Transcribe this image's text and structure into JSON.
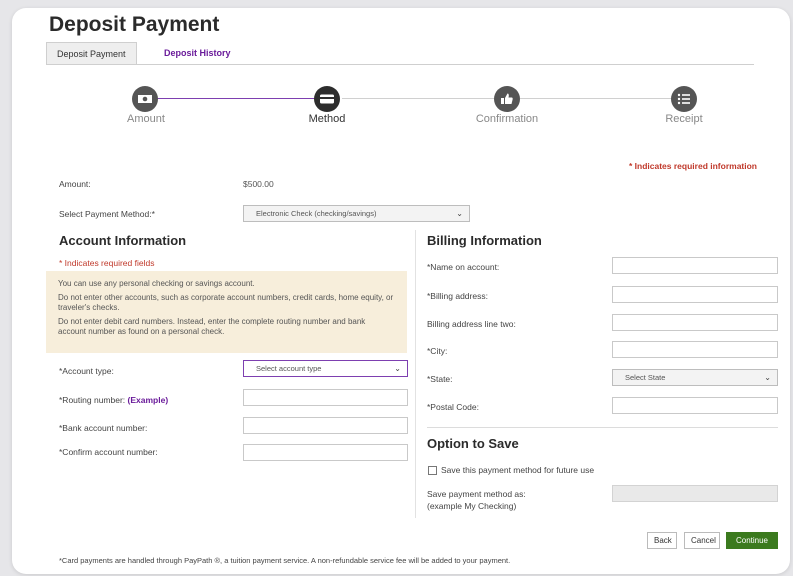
{
  "page": {
    "title": "Deposit Payment",
    "tabs": [
      {
        "label": "Deposit Payment"
      },
      {
        "label": "Deposit History"
      }
    ]
  },
  "steps": [
    {
      "label": "Amount",
      "icon": "money-icon"
    },
    {
      "label": "Method",
      "icon": "card-icon"
    },
    {
      "label": "Confirmation",
      "icon": "thumbs-up-icon"
    },
    {
      "label": "Receipt",
      "icon": "list-icon"
    }
  ],
  "required_note": "* Indicates required information",
  "amount": {
    "label": "Amount:",
    "value": "$500.00"
  },
  "payment_method": {
    "label": "Select Payment Method:*",
    "value": "Electronic Check (checking/savings)"
  },
  "account": {
    "heading": "Account Information",
    "required_note": "* Indicates required fields",
    "info": [
      "You can use any personal checking or savings account.",
      "Do not enter other accounts, such as corporate account numbers, credit cards, home equity, or traveler's checks.",
      "Do not enter debit card numbers. Instead, enter the complete routing number and bank account number as found on a personal check."
    ],
    "account_type": {
      "label": "*Account type:",
      "placeholder": "Select account type"
    },
    "routing": {
      "label": "*Routing number:",
      "example": "(Example)"
    },
    "bank_account": {
      "label": "*Bank account number:"
    },
    "confirm_account": {
      "label": "*Confirm account number:"
    }
  },
  "billing": {
    "heading": "Billing Information",
    "name": {
      "label": "*Name on account:"
    },
    "address": {
      "label": "*Billing address:"
    },
    "address2": {
      "label": "Billing address line two:"
    },
    "city": {
      "label": "*City:"
    },
    "state": {
      "label": "*State:",
      "placeholder": "Select State"
    },
    "postal": {
      "label": "*Postal Code:"
    }
  },
  "save": {
    "heading": "Option to Save",
    "checkbox_label": "Save this payment method for future use",
    "save_as_label": "Save payment method as:",
    "save_as_hint": "(example My Checking)"
  },
  "buttons": {
    "back": "Back",
    "cancel": "Cancel",
    "continue": "Continue"
  },
  "footer": "*Card payments are handled through PayPath ®, a tuition payment service. A non-refundable service fee will be added to your payment.",
  "colors": {
    "accent": "#6a1b9a",
    "required": "#c0392b",
    "continue": "#3b7a1e",
    "info_bg": "#f7eedb"
  }
}
